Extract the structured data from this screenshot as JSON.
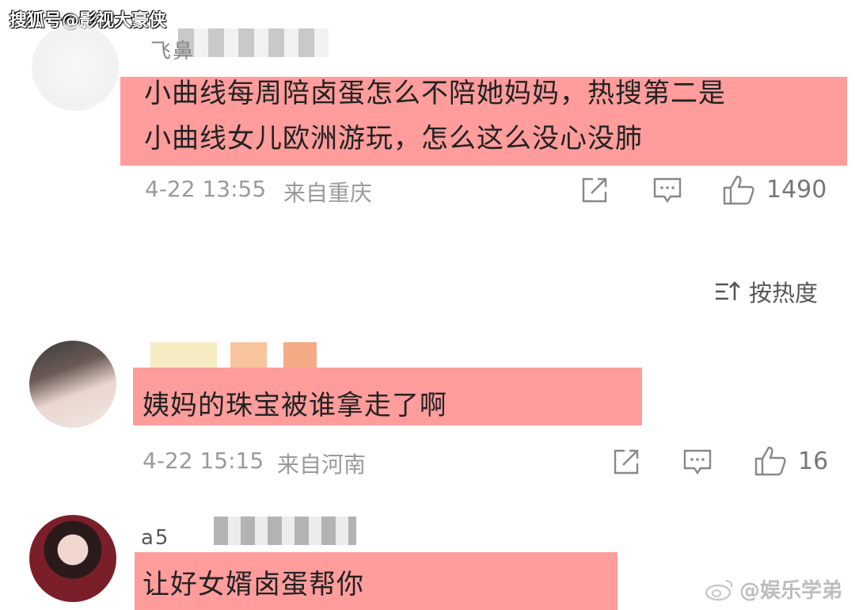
{
  "watermark": "搜狐号@影视大豪侠",
  "sort": {
    "label": "按热度",
    "icon": "sort-icon"
  },
  "comments": [
    {
      "username": "飞鼻",
      "lines": [
        "小曲线每周陪卤蛋怎么不陪她妈妈，热搜第二是",
        "小曲线女儿欧洲游玩，怎么这么没心没肺"
      ],
      "date": "4-22 13:55",
      "location": "来自重庆",
      "likes": "1490"
    },
    {
      "username": "",
      "lines": [
        "姨妈的珠宝被谁拿走了啊"
      ],
      "date": "4-22 15:15",
      "location": "来自河南",
      "likes": "16"
    },
    {
      "username": "a5",
      "lines": [
        "让好女婿卤蛋帮你"
      ]
    }
  ],
  "footer_watermark": "@娱乐学弟",
  "colors": {
    "highlight": "#ff9c9c",
    "meta": "#9a9a9a"
  }
}
